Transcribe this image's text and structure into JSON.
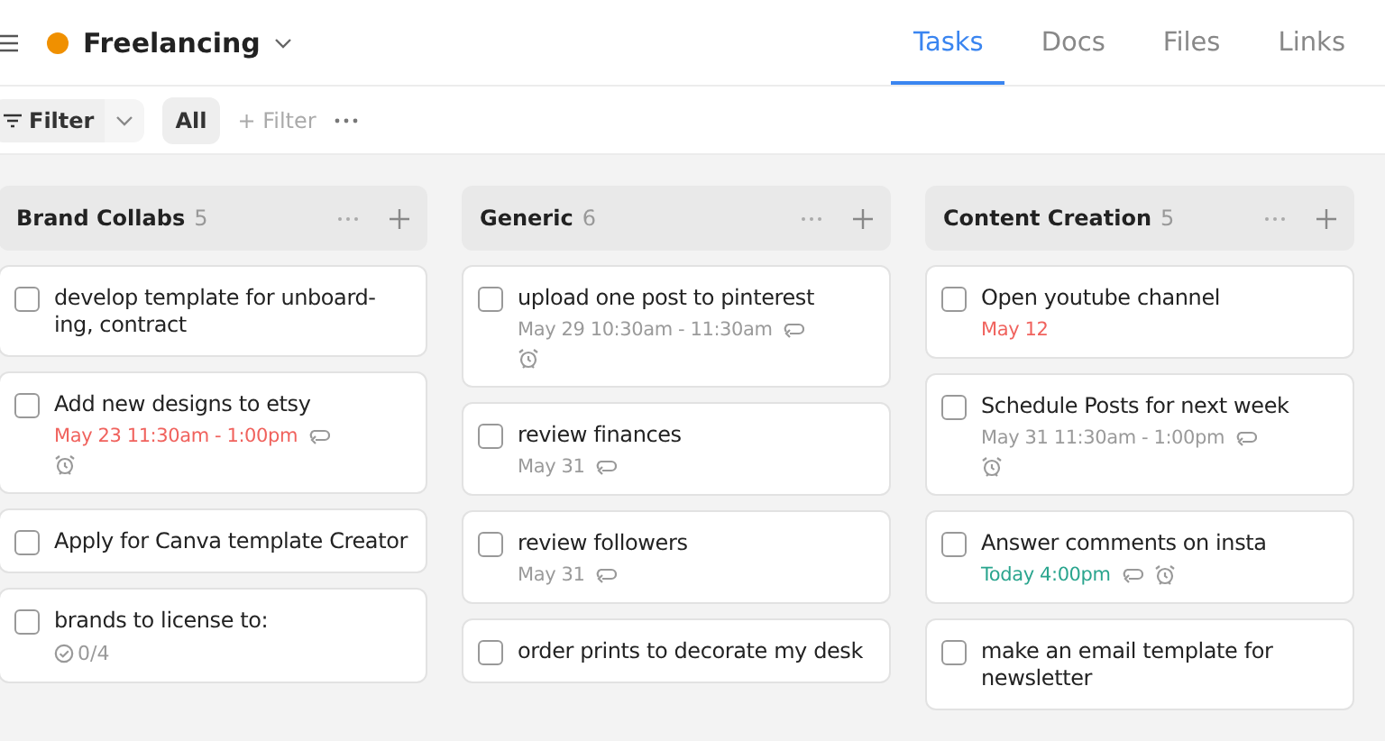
{
  "header": {
    "project": {
      "title": "Freelancing",
      "color": "#f09000"
    },
    "tabs": [
      {
        "label": "Tasks",
        "selected": true
      },
      {
        "label": "Docs",
        "selected": false
      },
      {
        "label": "Files",
        "selected": false
      },
      {
        "label": "Links",
        "selected": false
      }
    ]
  },
  "filter_bar": {
    "filter_button": "Filter",
    "view": {
      "label": "All",
      "selected": true
    },
    "add_filter": "+ Filter"
  },
  "columns": [
    {
      "title": "Brand Collabs",
      "count": "5",
      "tasks": [
        {
          "title": "develop template for unboard-ing, contract",
          "checked": false
        },
        {
          "title": "Add new designs to etsy",
          "checked": false,
          "date": "May 23 11:30am - 1:00pm",
          "color": "#f0625d",
          "repeat": true,
          "alarm": true
        },
        {
          "title": "Apply for Canva template Creator",
          "checked": false
        },
        {
          "title": "brands to license to:",
          "checked": false,
          "subtasks": "0/4"
        }
      ]
    },
    {
      "title": "Generic",
      "count": "6",
      "tasks": [
        {
          "title": "upload one post to pinterest",
          "checked": false,
          "date": "May 29 10:30am - 11:30am",
          "color": "#9a9a9a",
          "repeat": true,
          "alarm": true
        },
        {
          "title": "review finances",
          "checked": false,
          "date": "May 31",
          "color": "#9a9a9a",
          "repeat": true
        },
        {
          "title": "review followers",
          "checked": false,
          "date": "May 31",
          "color": "#9a9a9a",
          "repeat": true
        },
        {
          "title": "order prints to decorate my desk",
          "checked": false
        }
      ]
    },
    {
      "title": "Content Creation",
      "count": "5",
      "tasks": [
        {
          "title": "Open youtube channel",
          "checked": false,
          "date": "May 12",
          "color": "#f0625d"
        },
        {
          "title": "Schedule Posts for next week",
          "checked": false,
          "date": "May 31 11:30am - 1:00pm",
          "color": "#9a9a9a",
          "repeat": true,
          "alarm": true
        },
        {
          "title": "Answer comments on insta",
          "checked": false,
          "date": "Today 4:00pm",
          "color": "#2aa58e",
          "repeat": true,
          "alarm": true
        },
        {
          "title": "make an email template for newsletter",
          "checked": false
        }
      ]
    }
  ]
}
